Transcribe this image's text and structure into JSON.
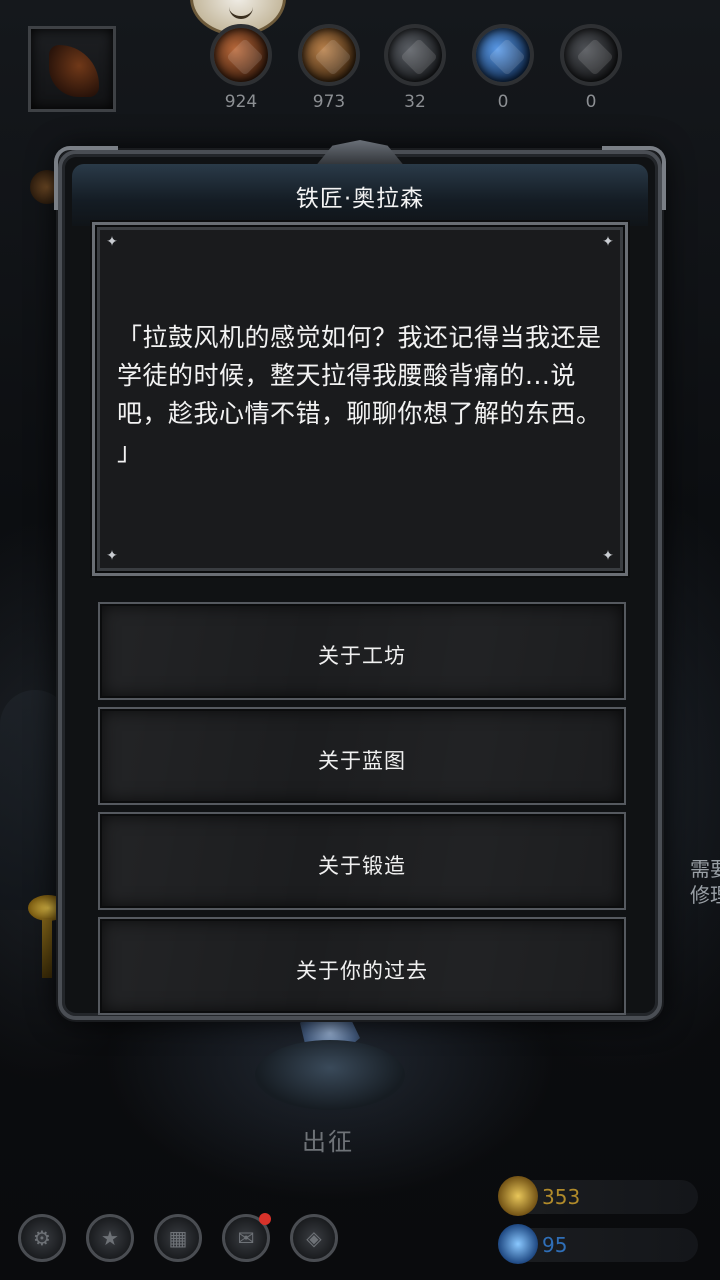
{
  "top": {
    "resources": [
      {
        "name": "bread-icon",
        "value": "924",
        "color": "#8a4a24"
      },
      {
        "name": "wood-icon",
        "value": "973",
        "color": "#8a5a2e"
      },
      {
        "name": "iron-ore-icon",
        "value": "32",
        "color": "#4a4d52"
      },
      {
        "name": "crystal-icon",
        "value": "0",
        "color": "#2a5a9a"
      },
      {
        "name": "steel-icon",
        "value": "0",
        "color": "#3a3c40"
      }
    ]
  },
  "dialog": {
    "title": "铁匠·奥拉森",
    "speech": "「拉鼓风机的感觉如何？我还记得当我还是学徒的时候，整天拉得我腰酸背痛的...说吧，趁我心情不错，聊聊你想了解的东西。 」",
    "options": [
      "关于工坊",
      "关于蓝图",
      "关于锻造",
      "关于你的过去"
    ]
  },
  "scene": {
    "depart_label": "出征",
    "right_hint": "需要\n修理"
  },
  "currency": {
    "gold": {
      "value": "353",
      "color": "#b08a2a",
      "icon": "gold-coin-icon"
    },
    "gem": {
      "value": "95",
      "color": "#2f6fb8",
      "icon": "blue-gem-icon"
    }
  },
  "bottom_nav": [
    "settings-icon",
    "achievement-icon",
    "inventory-icon",
    "mail-icon",
    "map-icon"
  ]
}
